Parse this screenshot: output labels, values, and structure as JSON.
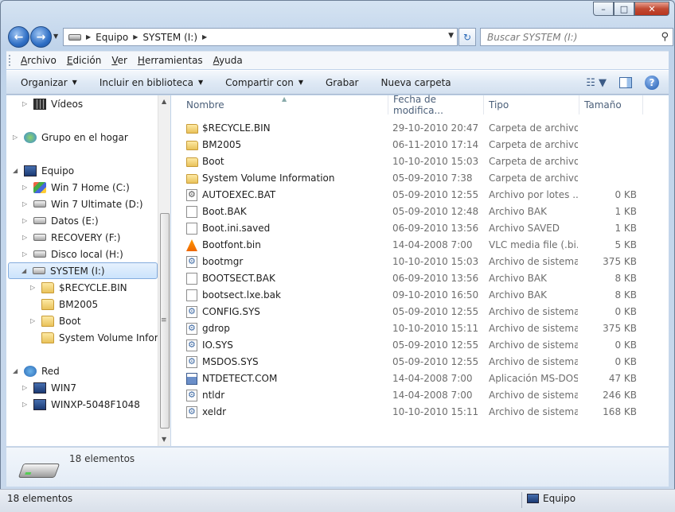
{
  "window": {
    "caption_buttons": {
      "minimize": "–",
      "maximize": "□",
      "close": "✕"
    }
  },
  "nav": {
    "back_glyph": "←",
    "forward_glyph": "→",
    "breadcrumb": [
      "Equipo",
      "SYSTEM (I:)"
    ],
    "search_placeholder": "Buscar SYSTEM (I:)",
    "refresh_glyph": "↻"
  },
  "menu": [
    "Archivo",
    "Edición",
    "Ver",
    "Herramientas",
    "Ayuda"
  ],
  "toolbar": {
    "organize": "Organizar",
    "include_library": "Incluir en biblioteca",
    "share": "Compartir con",
    "burn": "Grabar",
    "new_folder": "Nueva carpeta",
    "help_glyph": "?"
  },
  "tree": [
    {
      "label": "Vídeos",
      "icon": "video-icon"
    },
    {
      "label": "Grupo en el hogar",
      "icon": "homegroup-icon"
    },
    {
      "label": "Equipo",
      "icon": "computer-icon"
    },
    {
      "label": "Win 7 Home (C:)",
      "icon": "windows-drive-icon"
    },
    {
      "label": "Win 7 Ultimate (D:)",
      "icon": "drive-icon"
    },
    {
      "label": "Datos (E:)",
      "icon": "drive-icon"
    },
    {
      "label": "RECOVERY (F:)",
      "icon": "drive-icon"
    },
    {
      "label": "Disco local (H:)",
      "icon": "drive-icon"
    },
    {
      "label": "SYSTEM (I:)",
      "icon": "drive-icon",
      "selected": true
    },
    {
      "label": "$RECYCLE.BIN",
      "icon": "folder-icon"
    },
    {
      "label": "BM2005",
      "icon": "folder-icon"
    },
    {
      "label": "Boot",
      "icon": "folder-icon"
    },
    {
      "label": "System Volume Informa",
      "icon": "folder-icon"
    },
    {
      "label": "Red",
      "icon": "network-icon"
    },
    {
      "label": "WIN7",
      "icon": "computer-icon"
    },
    {
      "label": "WINXP-5048F1048",
      "icon": "computer-icon"
    }
  ],
  "columns": {
    "name": "Nombre",
    "date": "Fecha de modifica...",
    "type": "Tipo",
    "size": "Tamaño"
  },
  "files": [
    {
      "name": "$RECYCLE.BIN",
      "date": "29-10-2010 20:47",
      "type": "Carpeta de archivos",
      "size": "",
      "icon": "folder-icon"
    },
    {
      "name": "BM2005",
      "date": "06-11-2010 17:14",
      "type": "Carpeta de archivos",
      "size": "",
      "icon": "folder-icon"
    },
    {
      "name": "Boot",
      "date": "10-10-2010 15:03",
      "type": "Carpeta de archivos",
      "size": "",
      "icon": "folder-icon"
    },
    {
      "name": "System Volume Information",
      "date": "05-09-2010 7:38",
      "type": "Carpeta de archivos",
      "size": "",
      "icon": "folder-icon"
    },
    {
      "name": "AUTOEXEC.BAT",
      "date": "05-09-2010 12:55",
      "type": "Archivo por lotes ...",
      "size": "0 KB",
      "icon": "batch-file-icon"
    },
    {
      "name": "Boot.BAK",
      "date": "05-09-2010 12:48",
      "type": "Archivo BAK",
      "size": "1 KB",
      "icon": "file-icon"
    },
    {
      "name": "Boot.ini.saved",
      "date": "06-09-2010 13:56",
      "type": "Archivo SAVED",
      "size": "1 KB",
      "icon": "file-icon"
    },
    {
      "name": "Bootfont.bin",
      "date": "14-04-2008 7:00",
      "type": "VLC media file (.bi...",
      "size": "5 KB",
      "icon": "vlc-icon"
    },
    {
      "name": "bootmgr",
      "date": "10-10-2010 15:03",
      "type": "Archivo de sistema",
      "size": "375 KB",
      "icon": "system-file-icon"
    },
    {
      "name": "BOOTSECT.BAK",
      "date": "06-09-2010 13:56",
      "type": "Archivo BAK",
      "size": "8 KB",
      "icon": "file-icon"
    },
    {
      "name": "bootsect.lxe.bak",
      "date": "09-10-2010 16:50",
      "type": "Archivo BAK",
      "size": "8 KB",
      "icon": "file-icon"
    },
    {
      "name": "CONFIG.SYS",
      "date": "05-09-2010 12:55",
      "type": "Archivo de sistema",
      "size": "0 KB",
      "icon": "system-file-icon"
    },
    {
      "name": "gdrop",
      "date": "10-10-2010 15:11",
      "type": "Archivo de sistema",
      "size": "375 KB",
      "icon": "system-file-icon"
    },
    {
      "name": "IO.SYS",
      "date": "05-09-2010 12:55",
      "type": "Archivo de sistema",
      "size": "0 KB",
      "icon": "system-file-icon"
    },
    {
      "name": "MSDOS.SYS",
      "date": "05-09-2010 12:55",
      "type": "Archivo de sistema",
      "size": "0 KB",
      "icon": "system-file-icon"
    },
    {
      "name": "NTDETECT.COM",
      "date": "14-04-2008 7:00",
      "type": "Aplicación MS-DOS",
      "size": "47 KB",
      "icon": "msdos-app-icon"
    },
    {
      "name": "ntldr",
      "date": "14-04-2008 7:00",
      "type": "Archivo de sistema",
      "size": "246 KB",
      "icon": "system-file-icon"
    },
    {
      "name": "xeldr",
      "date": "10-10-2010 15:11",
      "type": "Archivo de sistema",
      "size": "168 KB",
      "icon": "system-file-icon"
    }
  ],
  "details_pane": {
    "count": "18 elementos"
  },
  "status": {
    "left": "18 elementos",
    "right": "Equipo"
  }
}
